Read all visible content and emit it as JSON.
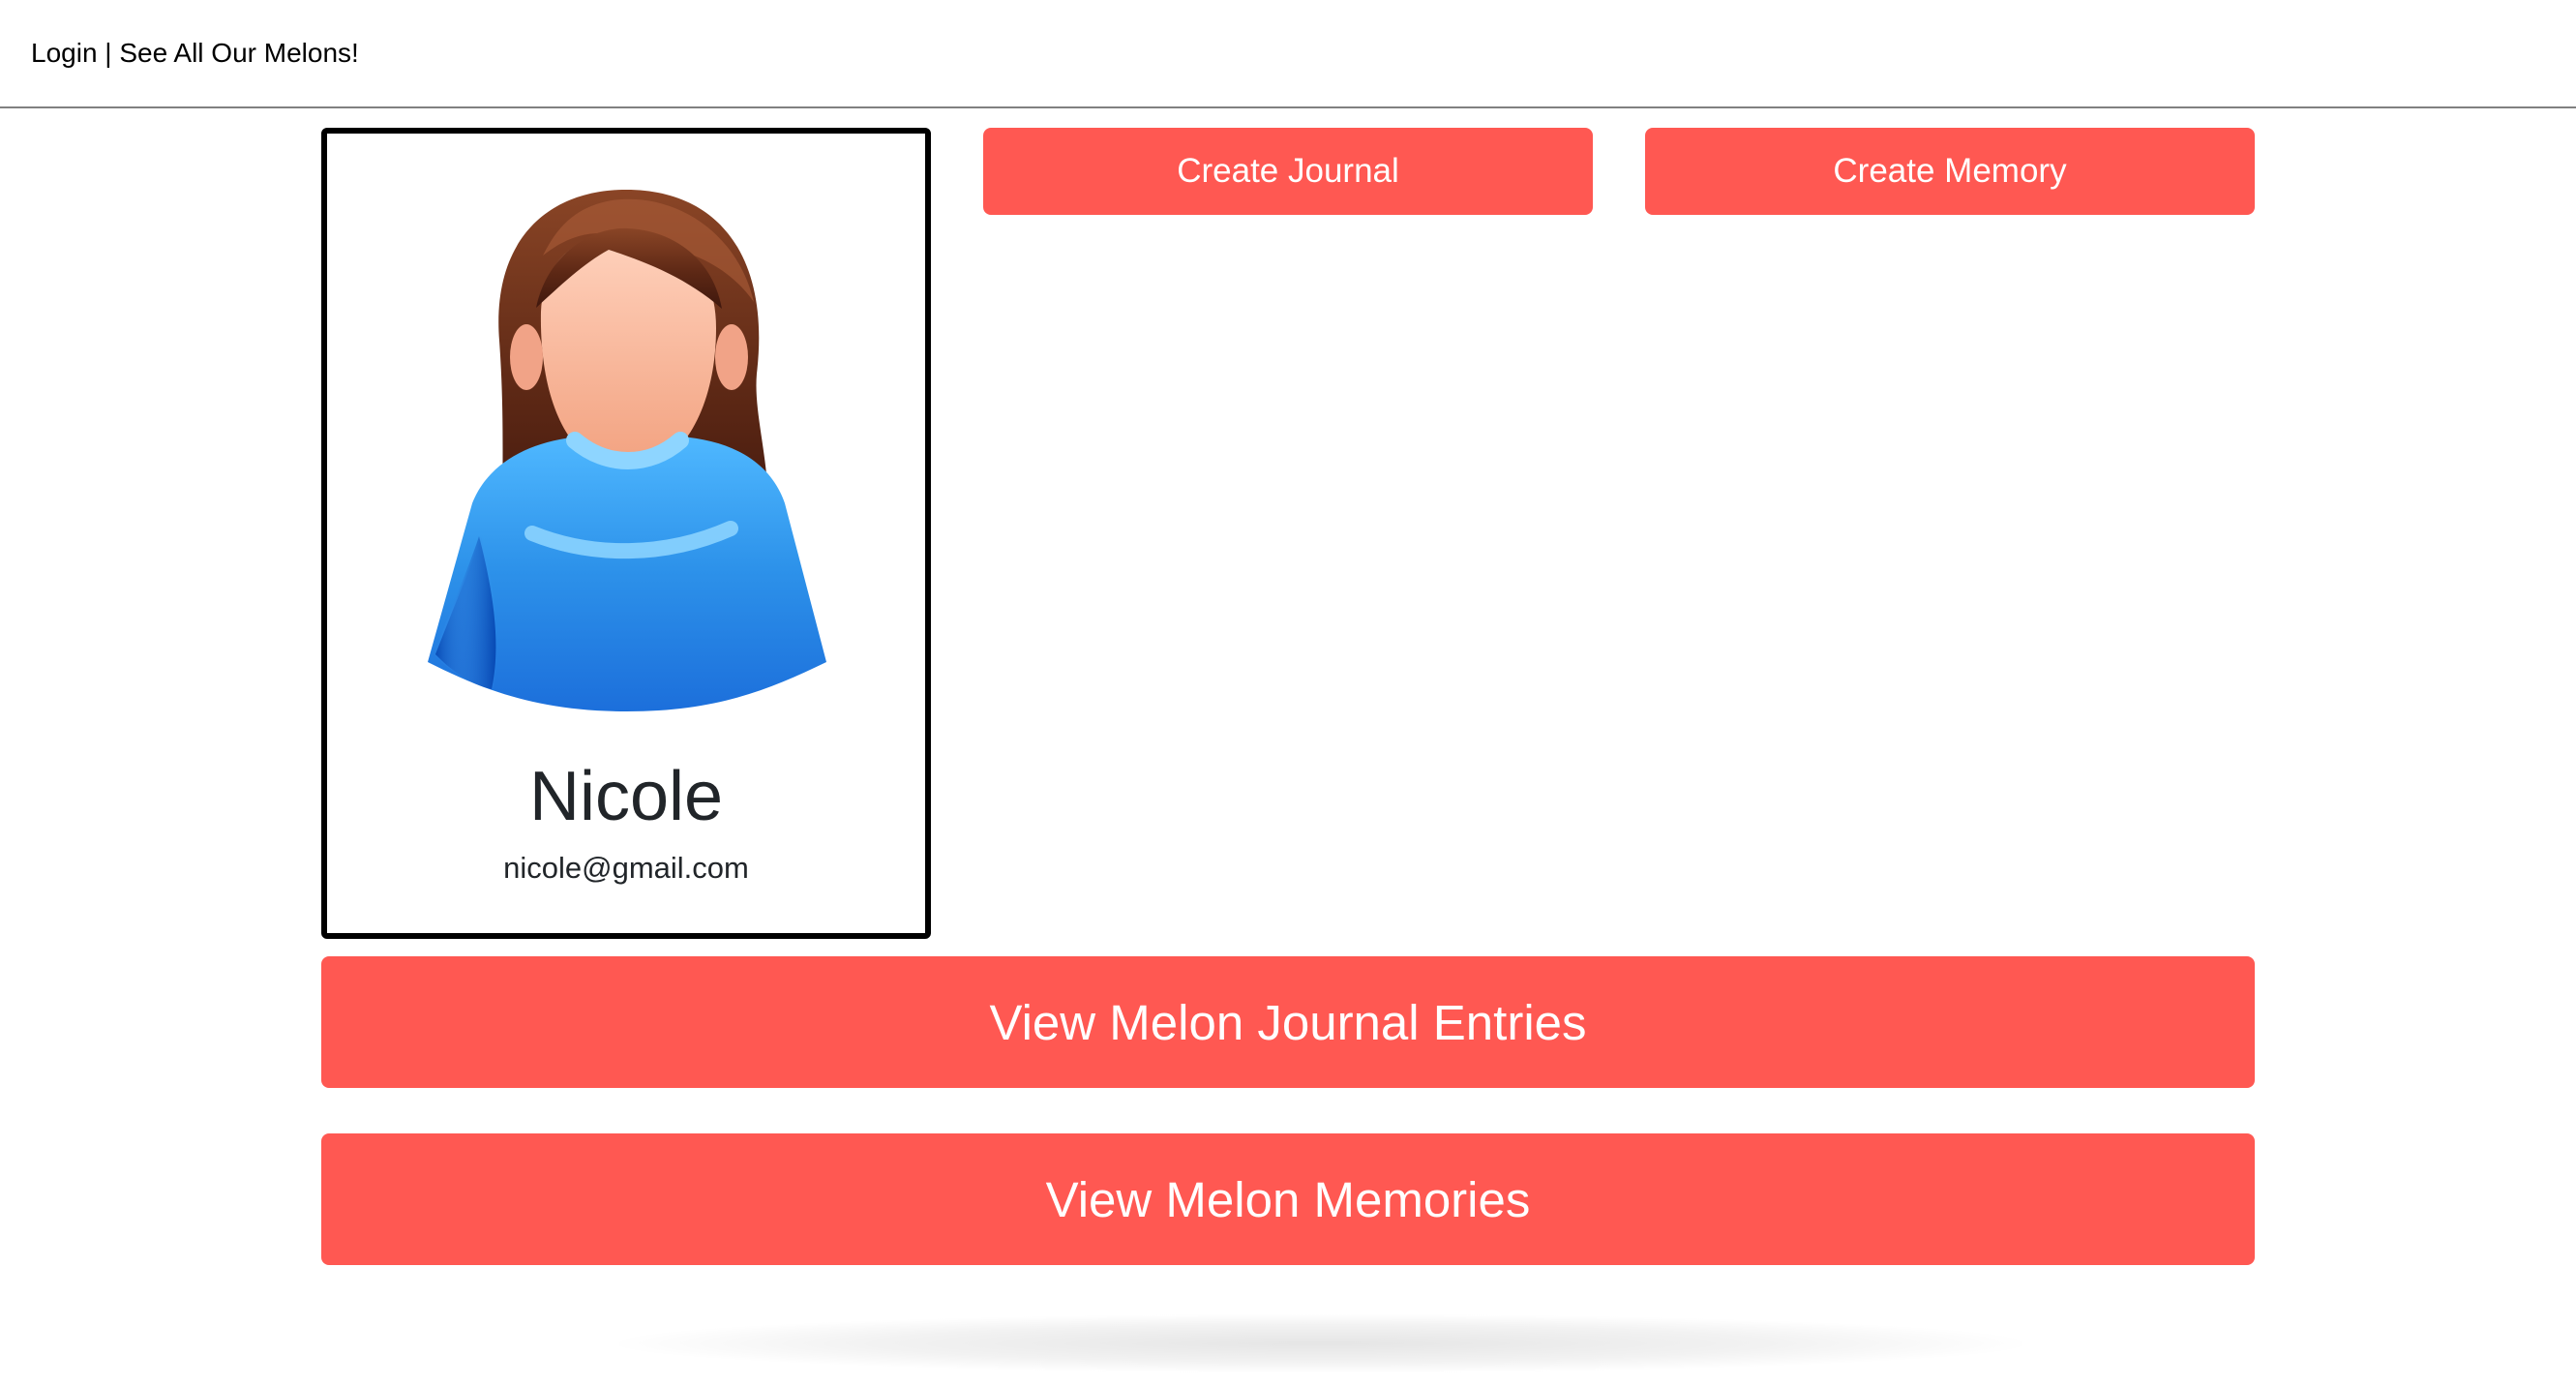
{
  "header": {
    "nav_text": "Login | See All Our Melons!"
  },
  "profile": {
    "name": "Nicole",
    "email": "nicole@gmail.com"
  },
  "actions": {
    "create_journal": "Create Journal",
    "create_memory": "Create Memory",
    "view_journal_entries": "View Melon Journal Entries",
    "view_memories": "View Melon Memories"
  },
  "colors": {
    "button": "#ff5852",
    "button_text": "#ffffff",
    "card_border": "#000000",
    "shirt_blue": "#2f8ff0",
    "hair_brown": "#6f3217"
  }
}
